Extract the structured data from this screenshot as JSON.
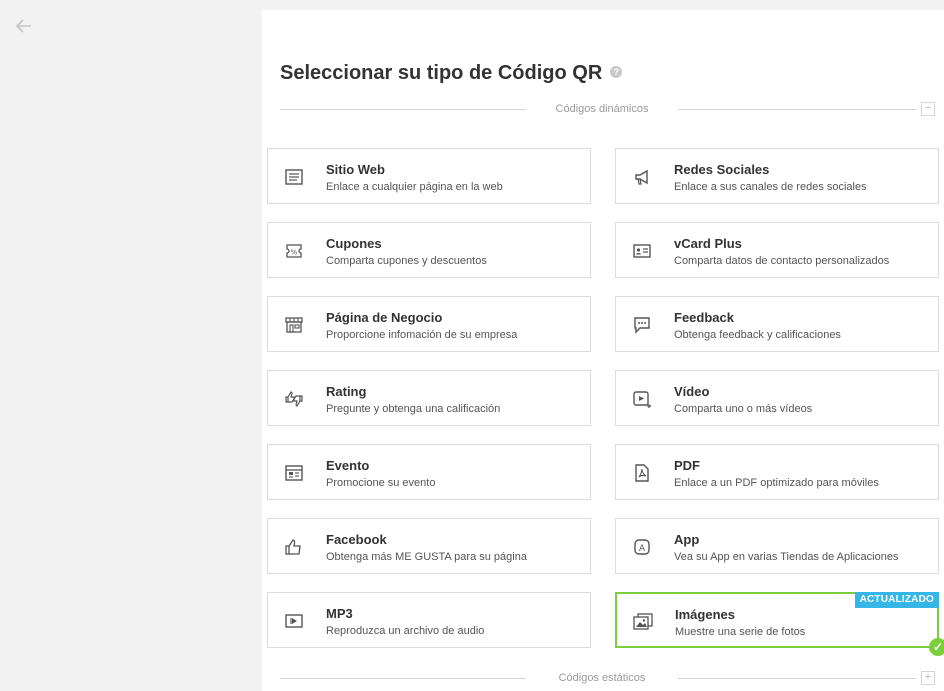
{
  "nav": {
    "back_icon": "arrow-left-icon"
  },
  "header": {
    "title": "Seleccionar su tipo de Código QR",
    "help_icon": "help-circle-icon",
    "help_glyph": "?"
  },
  "sections": {
    "dynamic": {
      "label": "Códigos dinámicos",
      "toggle": "−"
    },
    "static": {
      "label": "Códigos estáticos",
      "toggle": "+"
    }
  },
  "cards": [
    {
      "title": "Sitio Web",
      "description": "Enlace a cualquier página en la web",
      "icon": "website-icon"
    },
    {
      "title": "Redes Sociales",
      "description": "Enlace a sus canales de redes sociales",
      "icon": "megaphone-icon"
    },
    {
      "title": "Cupones",
      "description": "Comparta cupones y descuentos",
      "icon": "coupon-icon"
    },
    {
      "title": "vCard Plus",
      "description": "Comparta datos de contacto personalizados",
      "icon": "contact-card-icon"
    },
    {
      "title": "Página de Negocio",
      "description": "Proporcione infomación de su empresa",
      "icon": "storefront-icon"
    },
    {
      "title": "Feedback",
      "description": "Obtenga feedback y calificaciones",
      "icon": "chat-bubble-icon"
    },
    {
      "title": "Rating",
      "description": "Pregunte y obtenga una calificación",
      "icon": "thumbs-up-down-icon"
    },
    {
      "title": "Vídeo",
      "description": "Comparta uno o más vídeos",
      "icon": "video-play-icon"
    },
    {
      "title": "Evento",
      "description": "Promocione su evento",
      "icon": "calendar-icon"
    },
    {
      "title": "PDF",
      "description": "Enlace a un PDF optimizado para móviles",
      "icon": "pdf-icon"
    },
    {
      "title": "Facebook",
      "description": "Obtenga más ME GUSTA para su página",
      "icon": "thumbs-up-icon"
    },
    {
      "title": "App",
      "description": "Vea su App en varias Tiendas de Aplicaciones",
      "icon": "app-icon"
    },
    {
      "title": "MP3",
      "description": "Reproduzca un archivo de audio",
      "icon": "audio-play-icon"
    },
    {
      "title": "Imágenes",
      "description": "Muestre una serie de fotos",
      "icon": "images-icon",
      "badge": "ACTUALIZADO",
      "selected": true
    }
  ],
  "selected_check_glyph": "✓",
  "colors": {
    "selected_border": "#7ccf3c",
    "badge": "#36b6e6",
    "icon": "#555555"
  }
}
